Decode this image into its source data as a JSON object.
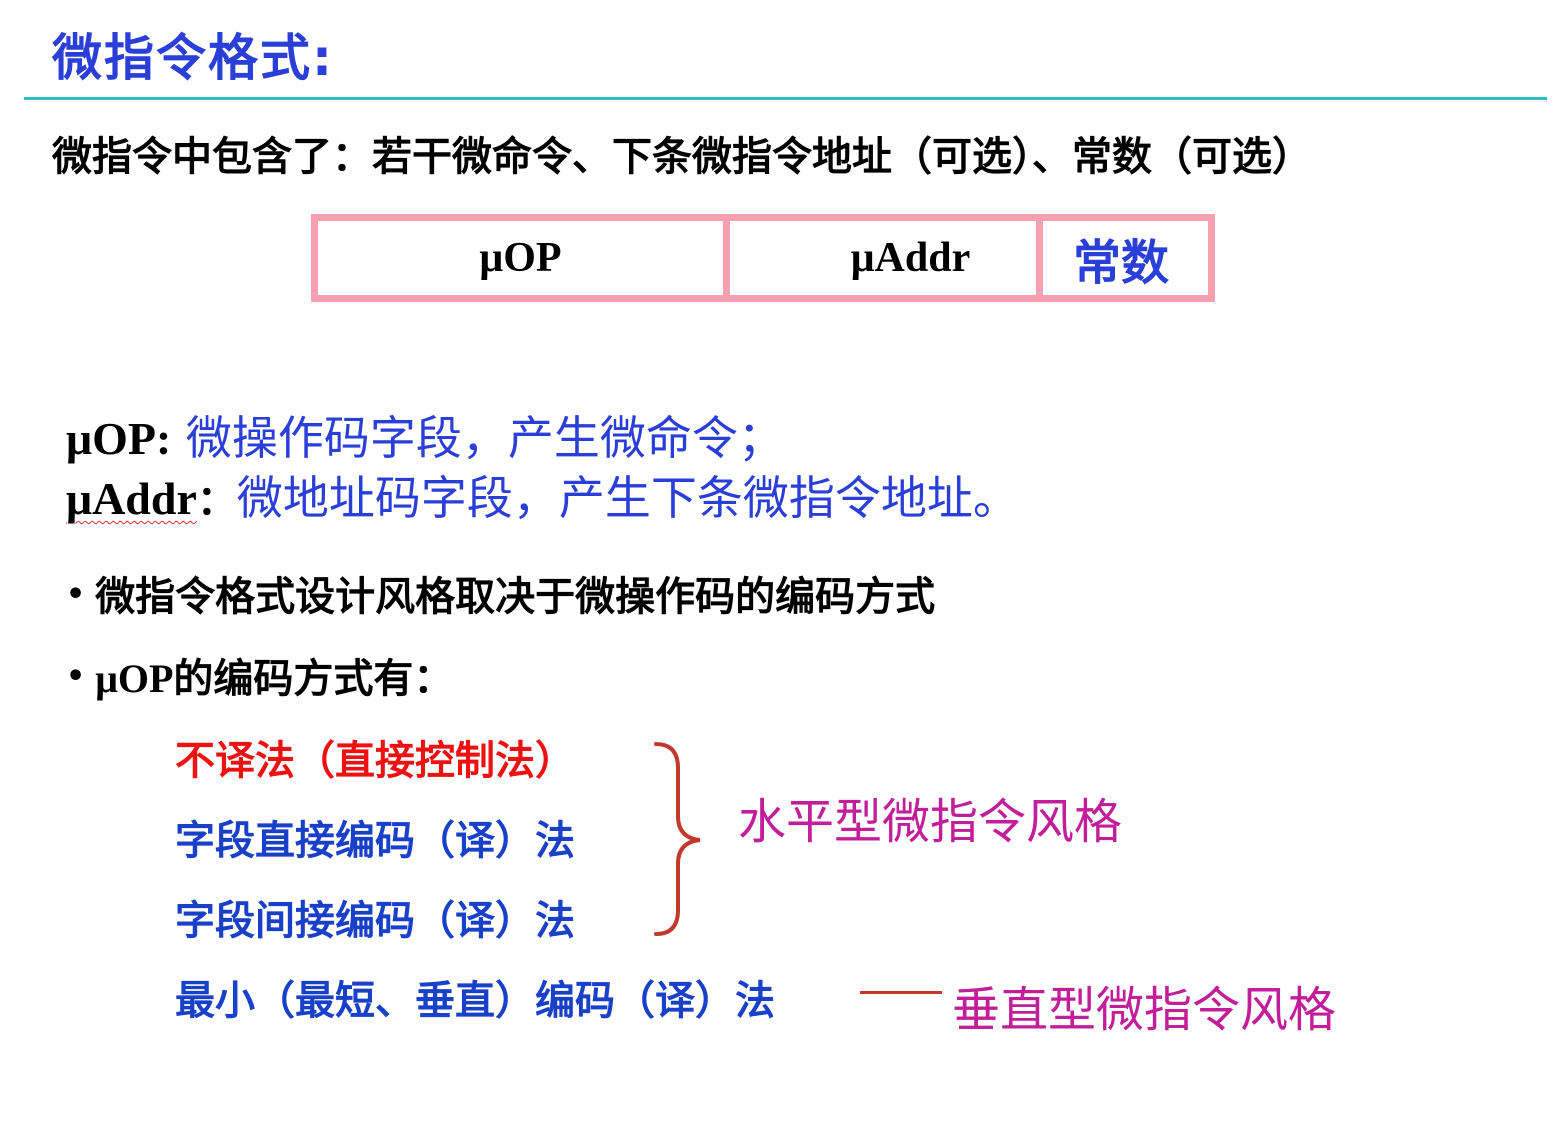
{
  "title": "微指令格式:",
  "intro": "微指令中包含了：若干微命令、下条微指令地址（可选）、常数（可选）",
  "format": {
    "fields": [
      "μOP",
      "μAddr",
      "常数"
    ]
  },
  "definitions": [
    {
      "key": "μOP:",
      "value": " 微操作码字段，产生微命令；"
    },
    {
      "key": "μAddr",
      "sep": "：",
      "value": "微地址码字段，产生下条微指令地址。"
    }
  ],
  "bullets": {
    "dot": "•",
    "b1": "微指令格式设计风格取决于微操作码的编码方式",
    "b2_prefix": "μOP",
    "b2_rest": "的编码方式有："
  },
  "methods": [
    "不译法（直接控制法）",
    "字段直接编码（译）法",
    "字段间接编码（译）法",
    "最小（最短、垂直）编码（译）法"
  ],
  "styles": {
    "horizontal": "水平型微指令风格",
    "vertical": "垂直型微指令风格"
  },
  "colors": {
    "title_blue": "#2a3fd8",
    "rule_teal": "#2fc1c1",
    "box_pink": "#f7a0b0",
    "red": "#ee1111",
    "magenta": "#c21e9a",
    "brace": "#c0392b"
  }
}
